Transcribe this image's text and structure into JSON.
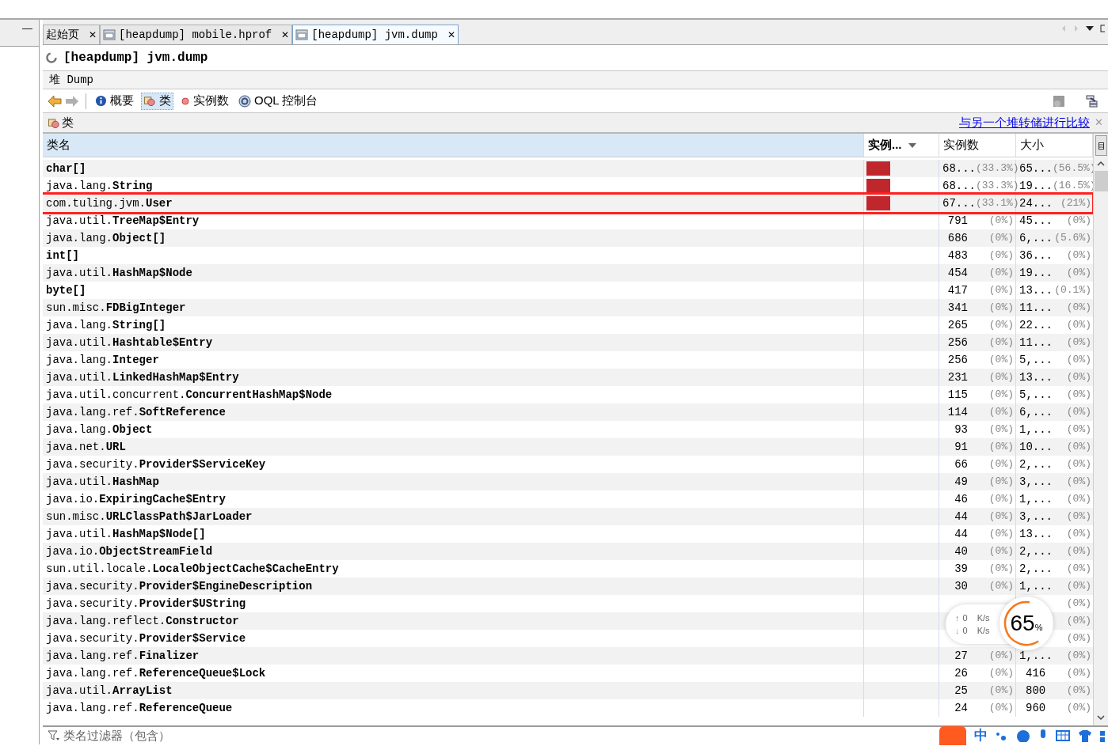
{
  "left_panel": {
    "minimize": "—"
  },
  "tabs": [
    {
      "label": "起始页",
      "icon": false,
      "selected": false,
      "close": "✕"
    },
    {
      "label": "[heapdump] mobile.hprof",
      "icon": true,
      "selected": false,
      "close": "✕"
    },
    {
      "label": "[heapdump] jvm.dump",
      "icon": true,
      "selected": true,
      "close": "✕"
    }
  ],
  "document_title": "[heapdump] jvm.dump",
  "section_title": "堆 Dump",
  "toolbar": [
    {
      "label": "概要",
      "kind": "info",
      "selected": false
    },
    {
      "label": "类",
      "kind": "classes",
      "selected": true
    },
    {
      "label": "实例数",
      "kind": "instances",
      "selected": false
    },
    {
      "label": "OQL 控制台",
      "kind": "oql",
      "selected": false
    }
  ],
  "panel": {
    "title": "类",
    "compare_link": "与另一个堆转储进行比较",
    "close": "✕"
  },
  "table": {
    "columns": [
      {
        "label": "类名",
        "sorted": false
      },
      {
        "label": "实例...",
        "sorted": true
      },
      {
        "label": "实例数",
        "sorted": false
      },
      {
        "label": "大小",
        "sorted": false
      }
    ],
    "rows": [
      {
        "package": "",
        "name": "char[]",
        "bar": true,
        "count": "68...",
        "count_pct": "(33.3%)",
        "size": "65...",
        "size_pct": "(56.5%)",
        "highlighted": false
      },
      {
        "package": "java.lang.",
        "name": "String",
        "bar": true,
        "count": "68...",
        "count_pct": "(33.3%)",
        "size": "19...",
        "size_pct": "(16.5%)",
        "highlighted": false
      },
      {
        "package": "com.tuling.jvm.",
        "name": "User",
        "bar": true,
        "count": "67...",
        "count_pct": "(33.1%)",
        "size": "24...",
        "size_pct": "(21%)",
        "highlighted": true
      },
      {
        "package": "java.util.",
        "name": "TreeMap$Entry",
        "bar": false,
        "count": "791",
        "count_pct": "(0%)",
        "size": "45...",
        "size_pct": "(0%)",
        "highlighted": false
      },
      {
        "package": "java.lang.",
        "name": "Object[]",
        "bar": false,
        "count": "686",
        "count_pct": "(0%)",
        "size": "6,...",
        "size_pct": "(5.6%)",
        "highlighted": false
      },
      {
        "package": "",
        "name": "int[]",
        "bar": false,
        "count": "483",
        "count_pct": "(0%)",
        "size": "36...",
        "size_pct": "(0%)",
        "highlighted": false
      },
      {
        "package": "java.util.",
        "name": "HashMap$Node",
        "bar": false,
        "count": "454",
        "count_pct": "(0%)",
        "size": "19...",
        "size_pct": "(0%)",
        "highlighted": false
      },
      {
        "package": "",
        "name": "byte[]",
        "bar": false,
        "count": "417",
        "count_pct": "(0%)",
        "size": "13...",
        "size_pct": "(0.1%)",
        "highlighted": false
      },
      {
        "package": "sun.misc.",
        "name": "FDBigInteger",
        "bar": false,
        "count": "341",
        "count_pct": "(0%)",
        "size": "11...",
        "size_pct": "(0%)",
        "highlighted": false
      },
      {
        "package": "java.lang.",
        "name": "String[]",
        "bar": false,
        "count": "265",
        "count_pct": "(0%)",
        "size": "22...",
        "size_pct": "(0%)",
        "highlighted": false
      },
      {
        "package": "java.util.",
        "name": "Hashtable$Entry",
        "bar": false,
        "count": "256",
        "count_pct": "(0%)",
        "size": "11...",
        "size_pct": "(0%)",
        "highlighted": false
      },
      {
        "package": "java.lang.",
        "name": "Integer",
        "bar": false,
        "count": "256",
        "count_pct": "(0%)",
        "size": "5,...",
        "size_pct": "(0%)",
        "highlighted": false
      },
      {
        "package": "java.util.",
        "name": "LinkedHashMap$Entry",
        "bar": false,
        "count": "231",
        "count_pct": "(0%)",
        "size": "13...",
        "size_pct": "(0%)",
        "highlighted": false
      },
      {
        "package": "java.util.concurrent.",
        "name": "ConcurrentHashMap$Node",
        "bar": false,
        "count": "115",
        "count_pct": "(0%)",
        "size": "5,...",
        "size_pct": "(0%)",
        "highlighted": false
      },
      {
        "package": "java.lang.ref.",
        "name": "SoftReference",
        "bar": false,
        "count": "114",
        "count_pct": "(0%)",
        "size": "6,...",
        "size_pct": "(0%)",
        "highlighted": false
      },
      {
        "package": "java.lang.",
        "name": "Object",
        "bar": false,
        "count": "93",
        "count_pct": "(0%)",
        "size": "1,...",
        "size_pct": "(0%)",
        "highlighted": false
      },
      {
        "package": "java.net.",
        "name": "URL",
        "bar": false,
        "count": "91",
        "count_pct": "(0%)",
        "size": "10...",
        "size_pct": "(0%)",
        "highlighted": false
      },
      {
        "package": "java.security.",
        "name": "Provider$ServiceKey",
        "bar": false,
        "count": "66",
        "count_pct": "(0%)",
        "size": "2,...",
        "size_pct": "(0%)",
        "highlighted": false
      },
      {
        "package": "java.util.",
        "name": "HashMap",
        "bar": false,
        "count": "49",
        "count_pct": "(0%)",
        "size": "3,...",
        "size_pct": "(0%)",
        "highlighted": false
      },
      {
        "package": "java.io.",
        "name": "ExpiringCache$Entry",
        "bar": false,
        "count": "46",
        "count_pct": "(0%)",
        "size": "1,...",
        "size_pct": "(0%)",
        "highlighted": false
      },
      {
        "package": "sun.misc.",
        "name": "URLClassPath$JarLoader",
        "bar": false,
        "count": "44",
        "count_pct": "(0%)",
        "size": "3,...",
        "size_pct": "(0%)",
        "highlighted": false
      },
      {
        "package": "java.util.",
        "name": "HashMap$Node[]",
        "bar": false,
        "count": "44",
        "count_pct": "(0%)",
        "size": "13...",
        "size_pct": "(0%)",
        "highlighted": false
      },
      {
        "package": "java.io.",
        "name": "ObjectStreamField",
        "bar": false,
        "count": "40",
        "count_pct": "(0%)",
        "size": "2,...",
        "size_pct": "(0%)",
        "highlighted": false
      },
      {
        "package": "sun.util.locale.",
        "name": "LocaleObjectCache$CacheEntry",
        "bar": false,
        "count": "39",
        "count_pct": "(0%)",
        "size": "2,...",
        "size_pct": "(0%)",
        "highlighted": false
      },
      {
        "package": "java.security.",
        "name": "Provider$EngineDescription",
        "bar": false,
        "count": "30",
        "count_pct": "(0%)",
        "size": "1,...",
        "size_pct": "(0%)",
        "highlighted": false
      },
      {
        "package": "java.security.",
        "name": "Provider$UString",
        "bar": false,
        "size_pct": "(0%)",
        "highlighted": false
      },
      {
        "package": "java.lang.reflect.",
        "name": "Constructor",
        "bar": false,
        "size_pct": "(0%)",
        "highlighted": false
      },
      {
        "package": "java.security.",
        "name": "Provider$Service",
        "bar": false,
        "size_pct": "(0%)",
        "highlighted": false
      },
      {
        "package": "java.lang.ref.",
        "name": "Finalizer",
        "bar": false,
        "count": "27",
        "count_pct": "(0%)",
        "size": "1,...",
        "size_pct": "(0%)",
        "highlighted": false
      },
      {
        "package": "java.lang.ref.",
        "name": "ReferenceQueue$Lock",
        "bar": false,
        "count": "26",
        "count_pct": "(0%)",
        "size": "416",
        "size_pct": "(0%)",
        "highlighted": false
      },
      {
        "package": "java.util.",
        "name": "ArrayList",
        "bar": false,
        "count": "25",
        "count_pct": "(0%)",
        "size": "800",
        "size_pct": "(0%)",
        "highlighted": false
      },
      {
        "package": "java.lang.ref.",
        "name": "ReferenceQueue",
        "bar": false,
        "count": "24",
        "count_pct": "(0%)",
        "size": "960",
        "size_pct": "(0%)",
        "highlighted": false
      }
    ]
  },
  "filter": {
    "placeholder": "类名过滤器（包含）"
  },
  "net_widget": {
    "up_arrow": "↑",
    "down_arrow": "↓",
    "up": "0",
    "down": "0",
    "unit_up": "K/s",
    "unit_down": "K/s",
    "percent": "65",
    "percent_sign": "%"
  },
  "ime_bar": {
    "mode": "中"
  }
}
